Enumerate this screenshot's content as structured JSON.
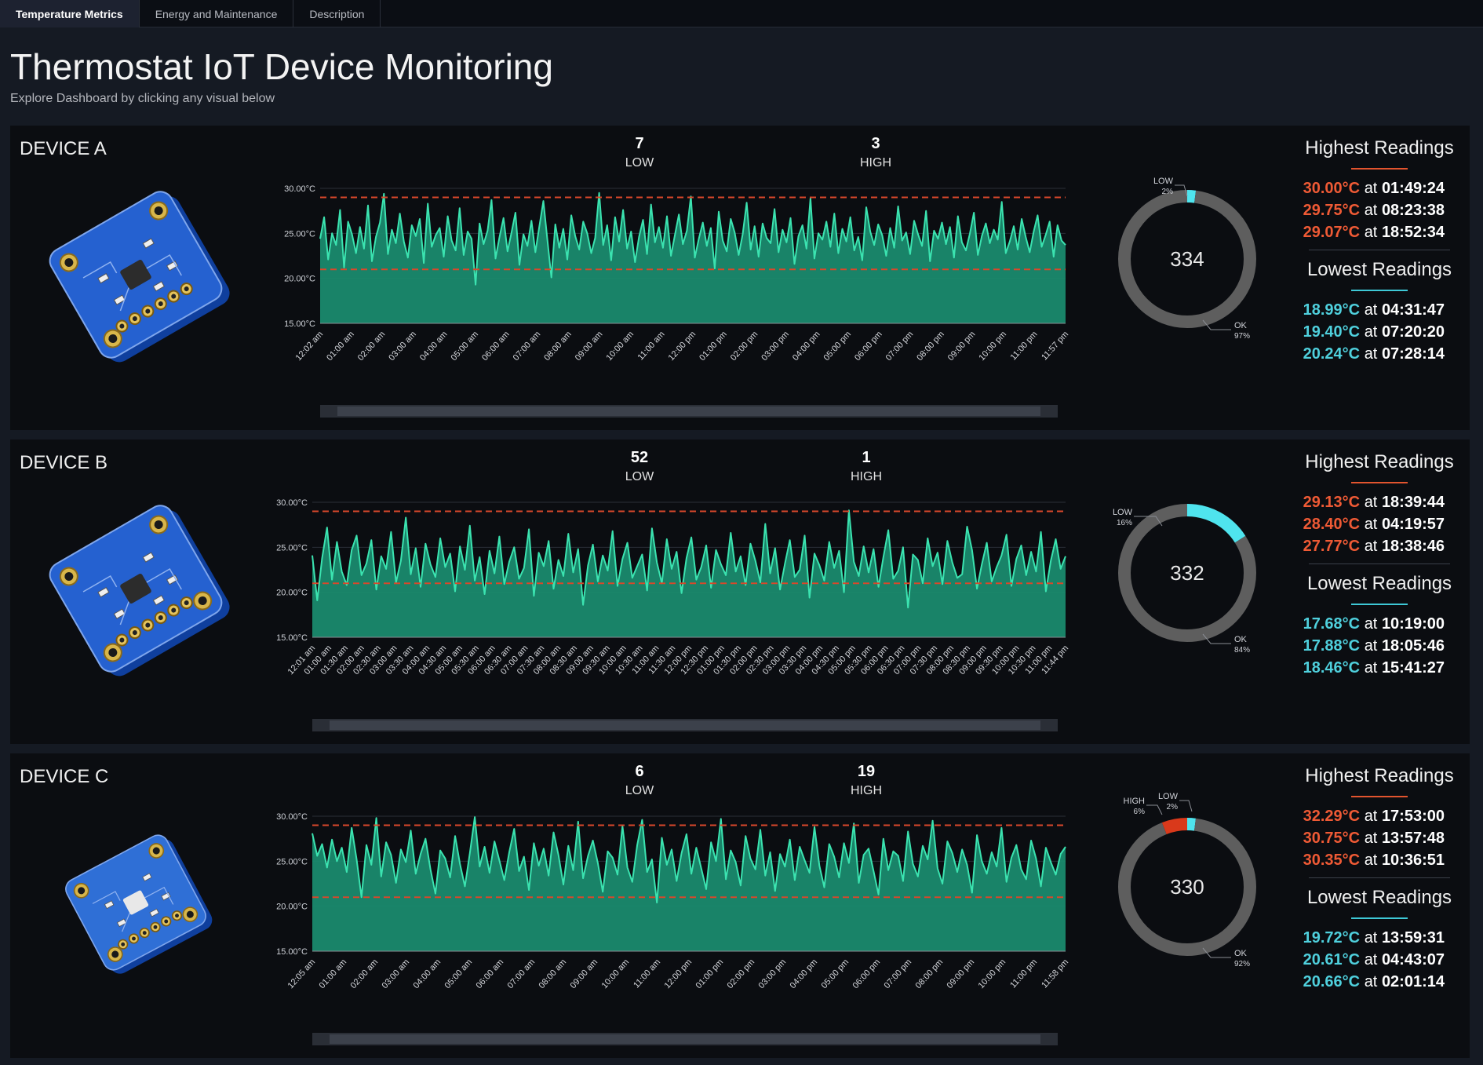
{
  "tabs": [
    {
      "label": "Temperature Metrics",
      "active": true
    },
    {
      "label": "Energy and Maintenance",
      "active": false
    },
    {
      "label": "Description",
      "active": false
    }
  ],
  "page": {
    "title": "Thermostat IoT Device Monitoring",
    "subtitle": "Explore Dashboard by clicking any visual below"
  },
  "colors": {
    "line": "#3be3b0",
    "area": "#1a8a6e",
    "threshold": "#d9482b",
    "low": "#4fe4ee",
    "high": "#d9391b",
    "ok": "#5e5e5e"
  },
  "panel_labels": {
    "low_label": "LOW",
    "high_label": "HIGH",
    "highest_heading": "Highest Readings",
    "lowest_heading": "Lowest Readings",
    "at": "at"
  },
  "devices": [
    {
      "name": "DEVICE A",
      "image_icon": "si7021-sensor-board-icon",
      "low_count": "7",
      "high_count": "3",
      "donut": {
        "total": "334",
        "segments": [
          {
            "label": "LOW",
            "pct": "2%",
            "value": 2
          },
          {
            "label": "OK",
            "pct": "97%",
            "value": 97
          }
        ]
      },
      "highest": [
        {
          "value": "30.00°C",
          "time": "01:49:24"
        },
        {
          "value": "29.75°C",
          "time": "08:23:38"
        },
        {
          "value": "29.07°C",
          "time": "18:52:34"
        }
      ],
      "lowest": [
        {
          "value": "18.99°C",
          "time": "04:31:47"
        },
        {
          "value": "19.40°C",
          "time": "07:20:20"
        },
        {
          "value": "20.24°C",
          "time": "07:28:14"
        }
      ],
      "chart_data": {
        "type": "area",
        "y_ticks": [
          "30.00°C",
          "25.00°C",
          "20.00°C",
          "15.00°C"
        ],
        "ylim": [
          15,
          30
        ],
        "thresholds": [
          29,
          21
        ],
        "x_ticks": [
          "12:02 am",
          "01:00 am",
          "02:00 am",
          "03:00 am",
          "04:00 am",
          "05:00 am",
          "06:00 am",
          "07:00 am",
          "08:00 am",
          "09:00 am",
          "10:00 am",
          "11:00 am",
          "12:00 pm",
          "01:00 pm",
          "02:00 pm",
          "03:00 pm",
          "04:00 pm",
          "05:00 pm",
          "06:00 pm",
          "07:00 pm",
          "08:00 pm",
          "09:00 pm",
          "10:00 pm",
          "11:00 pm",
          "11:57 pm"
        ],
        "values": [
          24.4,
          26.8,
          22.1,
          25.0,
          23.7,
          27.6,
          21.2,
          26.3,
          24.9,
          22.8,
          25.7,
          23.3,
          28.1,
          21.9,
          24.6,
          26.2,
          29.4,
          22.7,
          25.4,
          23.9,
          27.2,
          24.1,
          22.3,
          25.9,
          24.7,
          26.6,
          21.7,
          28.3,
          23.5,
          24.8,
          25.6,
          22.4,
          26.9,
          24.2,
          23.1,
          27.8,
          22.6,
          25.2,
          24.4,
          19.3,
          26.1,
          23.8,
          25.3,
          28.7,
          22.2,
          24.6,
          26.7,
          23.0,
          25.1,
          27.3,
          21.5,
          24.9,
          23.6,
          26.4,
          22.9,
          25.8,
          28.6,
          24.3,
          20.1,
          26.0,
          23.4,
          25.5,
          22.1,
          27.0,
          24.7,
          23.2,
          26.3,
          25.0,
          22.8,
          24.5,
          29.5,
          23.7,
          25.9,
          22.0,
          26.8,
          24.1,
          27.6,
          23.3,
          25.2,
          21.8,
          24.6,
          26.5,
          22.7,
          28.2,
          24.0,
          25.7,
          23.4,
          26.9,
          22.5,
          24.8,
          27.1,
          23.8,
          25.3,
          29.1,
          22.3,
          24.4,
          26.2,
          23.6,
          25.6,
          21.1,
          27.4,
          24.2,
          23.0,
          26.6,
          25.1,
          22.6,
          24.9,
          28.4,
          23.2,
          25.8,
          22.4,
          26.1,
          24.5,
          23.9,
          27.7,
          22.9,
          25.4,
          24.0,
          26.7,
          21.6,
          24.7,
          25.9,
          23.3,
          28.9,
          22.2,
          25.0,
          24.3,
          26.3,
          23.5,
          27.2,
          22.8,
          25.5,
          24.1,
          26.8,
          23.1,
          24.6,
          22.0,
          27.9,
          25.2,
          23.7,
          26.0,
          24.8,
          22.5,
          25.6,
          23.4,
          28.0,
          24.2,
          25.1,
          22.7,
          26.4,
          24.9,
          23.6,
          27.5,
          21.9,
          25.3,
          24.4,
          26.2,
          23.8,
          25.7,
          22.3,
          26.9,
          24.0,
          23.1,
          25.0,
          27.3,
          22.6,
          24.7,
          26.1,
          23.9,
          25.4,
          24.3,
          28.5,
          22.8,
          24.1,
          25.8,
          23.2,
          26.6,
          24.6,
          22.9,
          25.2,
          27.0,
          23.5,
          24.8,
          26.3,
          22.4,
          25.9,
          24.2,
          23.7
        ]
      }
    },
    {
      "name": "DEVICE B",
      "image_icon": "hdc100x-humidity-temp-sensor-board-icon",
      "low_count": "52",
      "high_count": "1",
      "donut": {
        "total": "332",
        "segments": [
          {
            "label": "LOW",
            "pct": "16%",
            "value": 16
          },
          {
            "label": "OK",
            "pct": "84%",
            "value": 84
          }
        ]
      },
      "highest": [
        {
          "value": "29.13°C",
          "time": "18:39:44"
        },
        {
          "value": "28.40°C",
          "time": "04:19:57"
        },
        {
          "value": "27.77°C",
          "time": "18:38:46"
        }
      ],
      "lowest": [
        {
          "value": "17.68°C",
          "time": "10:19:00"
        },
        {
          "value": "17.88°C",
          "time": "18:05:46"
        },
        {
          "value": "18.46°C",
          "time": "15:41:27"
        }
      ],
      "chart_data": {
        "type": "area",
        "y_ticks": [
          "30.00°C",
          "25.00°C",
          "20.00°C",
          "15.00°C"
        ],
        "ylim": [
          15,
          30
        ],
        "thresholds": [
          29,
          21
        ],
        "x_ticks": [
          "12:01 am",
          "01:00 am",
          "01:30 am",
          "02:00 am",
          "02:30 am",
          "03:00 am",
          "03:30 am",
          "04:00 am",
          "04:30 am",
          "05:00 am",
          "05:30 am",
          "06:00 am",
          "06:30 am",
          "07:00 am",
          "07:30 am",
          "08:00 am",
          "08:30 am",
          "09:00 am",
          "09:30 am",
          "10:00 am",
          "10:30 am",
          "11:00 am",
          "11:30 am",
          "12:00 pm",
          "12:30 pm",
          "01:00 pm",
          "01:30 pm",
          "02:00 pm",
          "02:30 pm",
          "03:00 pm",
          "03:30 pm",
          "04:00 pm",
          "04:30 pm",
          "05:00 pm",
          "05:30 pm",
          "06:00 pm",
          "06:30 pm",
          "07:00 pm",
          "07:30 pm",
          "08:00 pm",
          "08:30 pm",
          "09:00 pm",
          "09:30 pm",
          "10:00 pm",
          "10:30 pm",
          "11:00 pm",
          "11:44 pm"
        ],
        "values": [
          24.1,
          19.1,
          23.8,
          27.2,
          21.4,
          25.6,
          22.3,
          20.8,
          24.7,
          26.3,
          21.9,
          23.2,
          25.8,
          20.3,
          24.0,
          22.6,
          26.7,
          21.1,
          23.5,
          28.3,
          22.0,
          24.9,
          20.6,
          25.4,
          23.1,
          21.7,
          26.0,
          22.8,
          24.3,
          20.1,
          25.1,
          22.5,
          27.4,
          21.3,
          23.9,
          19.8,
          24.6,
          22.1,
          26.2,
          20.9,
          23.4,
          25.0,
          21.5,
          22.7,
          27.0,
          19.6,
          24.4,
          22.9,
          25.7,
          20.4,
          23.6,
          21.8,
          26.5,
          22.2,
          24.8,
          18.6,
          23.0,
          25.3,
          21.2,
          24.1,
          22.4,
          26.8,
          20.7,
          23.7,
          25.5,
          21.6,
          22.9,
          24.2,
          20.2,
          27.1,
          23.3,
          21.0,
          25.9,
          22.6,
          24.5,
          19.9,
          23.8,
          26.1,
          21.4,
          22.8,
          25.2,
          20.5,
          24.7,
          23.1,
          21.9,
          26.6,
          22.3,
          24.0,
          20.8,
          25.4,
          23.5,
          21.1,
          27.6,
          22.1,
          24.9,
          20.3,
          23.2,
          25.8,
          21.7,
          22.5,
          26.3,
          19.4,
          24.3,
          23.0,
          21.3,
          25.6,
          22.7,
          24.6,
          20.0,
          29.1,
          23.4,
          21.8,
          25.1,
          22.2,
          24.8,
          20.6,
          23.9,
          26.9,
          21.5,
          22.4,
          25.0,
          18.3,
          24.2,
          23.6,
          21.0,
          26.0,
          22.9,
          24.4,
          20.9,
          25.7,
          23.3,
          21.6,
          22.0,
          27.3,
          24.7,
          20.4,
          23.1,
          25.5,
          21.2,
          22.8,
          24.1,
          26.4,
          20.7,
          23.7,
          25.2,
          21.9,
          24.5,
          22.3,
          26.7,
          20.1,
          23.5,
          25.9,
          22.6,
          24.0
        ]
      }
    },
    {
      "name": "DEVICE C",
      "image_icon": "si7021-rh-temp-sensor-board-icon",
      "low_count": "6",
      "high_count": "19",
      "donut": {
        "total": "330",
        "segments": [
          {
            "label": "LOW",
            "pct": "2%",
            "value": 2
          },
          {
            "label": "HIGH",
            "pct": "6%",
            "value": 6
          },
          {
            "label": "OK",
            "pct": "92%",
            "value": 92
          }
        ]
      },
      "highest": [
        {
          "value": "32.29°C",
          "time": "17:53:00"
        },
        {
          "value": "30.75°C",
          "time": "13:57:48"
        },
        {
          "value": "30.35°C",
          "time": "10:36:51"
        }
      ],
      "lowest": [
        {
          "value": "19.72°C",
          "time": "13:59:31"
        },
        {
          "value": "20.61°C",
          "time": "04:43:07"
        },
        {
          "value": "20.66°C",
          "time": "02:01:14"
        }
      ],
      "chart_data": {
        "type": "area",
        "y_ticks": [
          "30.00°C",
          "25.00°C",
          "20.00°C",
          "15.00°C"
        ],
        "ylim": [
          15,
          30
        ],
        "thresholds": [
          29,
          21
        ],
        "x_ticks": [
          "12:05 am",
          "01:00 am",
          "02:00 am",
          "03:00 am",
          "04:00 am",
          "05:00 am",
          "06:00 am",
          "07:00 am",
          "08:00 am",
          "09:00 am",
          "10:00 am",
          "11:00 am",
          "12:00 pm",
          "01:00 pm",
          "02:00 pm",
          "03:00 pm",
          "04:00 pm",
          "05:00 pm",
          "06:00 pm",
          "07:00 pm",
          "08:00 pm",
          "09:00 pm",
          "10:00 pm",
          "11:00 pm",
          "11:58 pm"
        ],
        "values": [
          28.1,
          25.6,
          26.9,
          24.3,
          27.4,
          25.0,
          26.5,
          23.8,
          28.7,
          25.2,
          21.0,
          26.8,
          24.6,
          29.8,
          23.3,
          27.1,
          25.7,
          22.6,
          26.3,
          24.9,
          28.4,
          23.6,
          25.8,
          27.5,
          24.1,
          21.4,
          26.2,
          25.3,
          23.2,
          27.8,
          24.7,
          22.2,
          25.9,
          29.9,
          24.4,
          26.6,
          23.7,
          27.2,
          25.1,
          22.9,
          26.0,
          28.6,
          23.9,
          25.5,
          21.8,
          27.0,
          24.5,
          26.4,
          23.4,
          28.2,
          25.7,
          22.4,
          26.7,
          24.0,
          29.4,
          23.1,
          25.6,
          27.3,
          24.8,
          21.6,
          26.1,
          25.4,
          23.5,
          28.9,
          24.3,
          22.7,
          26.8,
          29.6,
          23.8,
          25.2,
          20.4,
          27.6,
          24.6,
          26.3,
          22.8,
          25.9,
          28.0,
          23.6,
          26.5,
          24.2,
          21.9,
          27.1,
          25.0,
          29.7,
          23.0,
          26.2,
          24.9,
          22.3,
          27.8,
          25.3,
          24.1,
          28.5,
          23.4,
          26.0,
          21.7,
          25.8,
          24.4,
          27.4,
          22.9,
          26.6,
          25.1,
          23.7,
          28.8,
          24.5,
          22.1,
          26.9,
          25.5,
          23.2,
          27.0,
          24.8,
          29.2,
          22.6,
          25.7,
          26.4,
          23.9,
          21.3,
          27.5,
          24.0,
          26.1,
          25.6,
          22.8,
          28.3,
          24.7,
          23.3,
          26.7,
          25.2,
          29.5,
          24.2,
          22.5,
          27.2,
          25.9,
          23.8,
          26.3,
          24.6,
          21.5,
          27.9,
          25.0,
          23.6,
          26.0,
          24.4,
          28.7,
          22.7,
          25.4,
          26.8,
          24.1,
          23.0,
          27.3,
          25.3,
          22.2,
          26.5,
          24.9,
          23.5,
          25.8,
          26.6
        ]
      }
    }
  ]
}
